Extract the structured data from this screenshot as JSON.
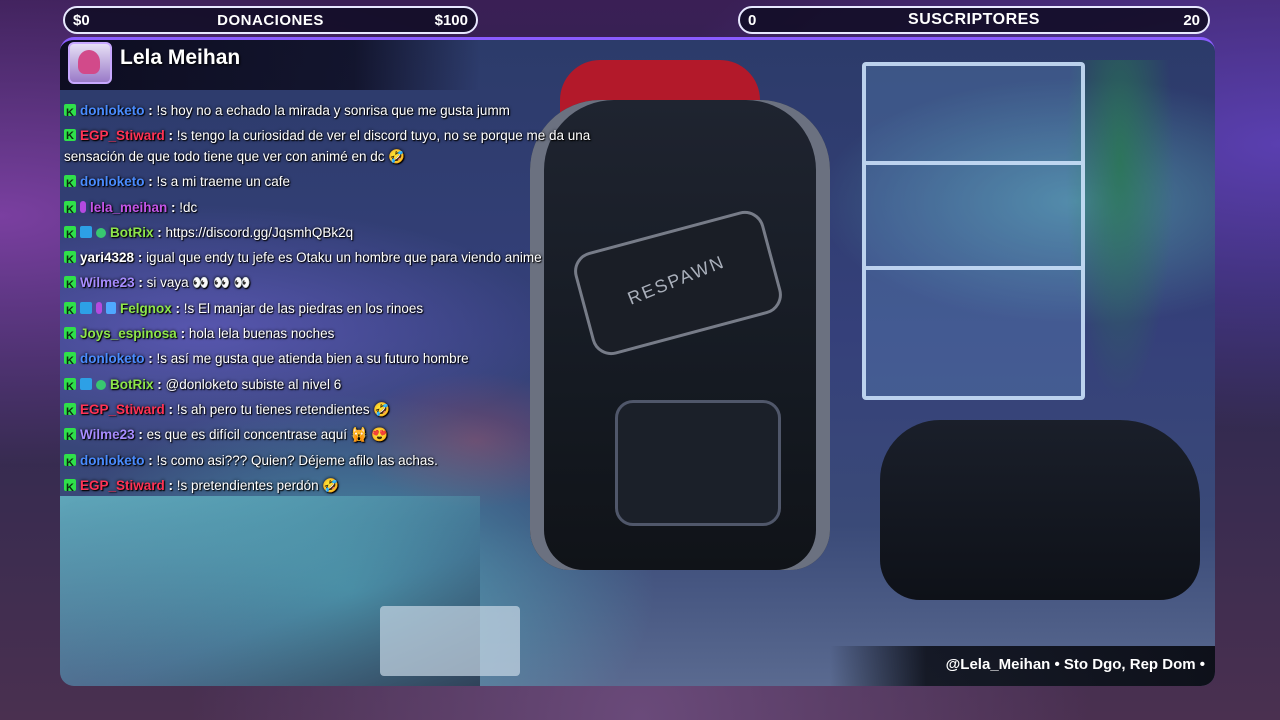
{
  "donations_bar": {
    "min": "$0",
    "label": "DONACIONES",
    "max": "$100"
  },
  "subscribers_bar": {
    "min": "0",
    "label": "SUSCRIPTORES",
    "max": "20"
  },
  "header": {
    "streamer_name": "Lela Meihan"
  },
  "scene": {
    "chair_brand": "RESPAWN"
  },
  "chat": {
    "messages": [
      {
        "user": "donloketo",
        "user_color": "#4a8cff",
        "text": "!s hoy no a echado la mirada y sonrisa que me gusta jumm"
      },
      {
        "user": "EGP_Stiward",
        "user_color": "#ff3355",
        "text": "!s tengo la curiosidad de ver el discord tuyo, no se porque me da una sensación de que todo tiene que ver con animé en dc 🤣"
      },
      {
        "user": "donloketo",
        "user_color": "#4a8cff",
        "text": "!s a mi traeme un cafe"
      },
      {
        "user": "lela_meihan",
        "user_color": "#c455e8",
        "text": "!dc"
      },
      {
        "user": "BotRix",
        "user_color": "#8ee64a",
        "text": "https://discord.gg/JqsmhQBk2q"
      },
      {
        "user": "yari4328",
        "user_color": "#ffffff",
        "text": "igual que endy tu jefe es Otaku un hombre que para viendo anime"
      },
      {
        "user": "Wilme23",
        "user_color": "#a78cff",
        "text": "si vaya 👀 👀 👀"
      },
      {
        "user": "Felgnox",
        "user_color": "#8ee64a",
        "text": "!s El manjar de las piedras en los rinoes"
      },
      {
        "user": "Joys_espinosa",
        "user_color": "#8ee64a",
        "text": "hola lela buenas noches"
      },
      {
        "user": "donloketo",
        "user_color": "#4a8cff",
        "text": "!s así me gusta que atienda bien a su futuro hombre"
      },
      {
        "user": "BotRix",
        "user_color": "#8ee64a",
        "text": "@donloketo subiste al nivel 6"
      },
      {
        "user": "EGP_Stiward",
        "user_color": "#ff3355",
        "text": "!s ah pero tu tienes retendientes 🤣"
      },
      {
        "user": "Wilme23",
        "user_color": "#a78cff",
        "text": "es que es difícil concentrase aquí 🙀 😍"
      },
      {
        "user": "donloketo",
        "user_color": "#4a8cff",
        "text": "!s como asi??? Quien? Déjeme afilo las achas."
      },
      {
        "user": "EGP_Stiward",
        "user_color": "#ff3355",
        "text": "!s pretendientes perdón 🤣"
      }
    ]
  },
  "footer": {
    "text": "@Lela_Meihan • Sto Dgo, Rep Dom •"
  },
  "colors": {
    "accent": "#8a5cff",
    "kick_green": "#2fe04a"
  }
}
